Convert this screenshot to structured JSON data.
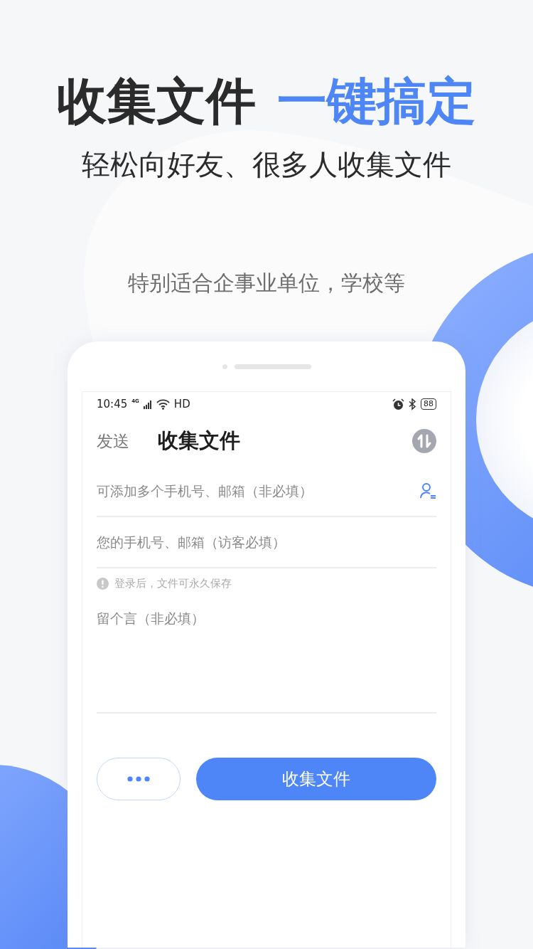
{
  "headline": {
    "text": "收集文件",
    "highlight": "一键搞定"
  },
  "subtitle": "轻松向好友、很多人收集文件",
  "tagline": "特别适合企事业单位，学校等",
  "status_bar": {
    "time": "10:45",
    "network": "4G",
    "hd": "HD",
    "battery": "88"
  },
  "tabs": [
    {
      "label": "发送",
      "selected": false
    },
    {
      "label": "收集文件",
      "selected": true
    }
  ],
  "fields": [
    {
      "placeholder": "可添加多个手机号、邮箱（非必填）",
      "kind": "contacts"
    },
    {
      "placeholder": "您的手机号、邮箱（访客必填）",
      "kind": "plain"
    }
  ],
  "hint": "登录后，文件可永久保存",
  "message": {
    "placeholder": "留个言（非必填）"
  },
  "submit_button": "收集文件"
}
